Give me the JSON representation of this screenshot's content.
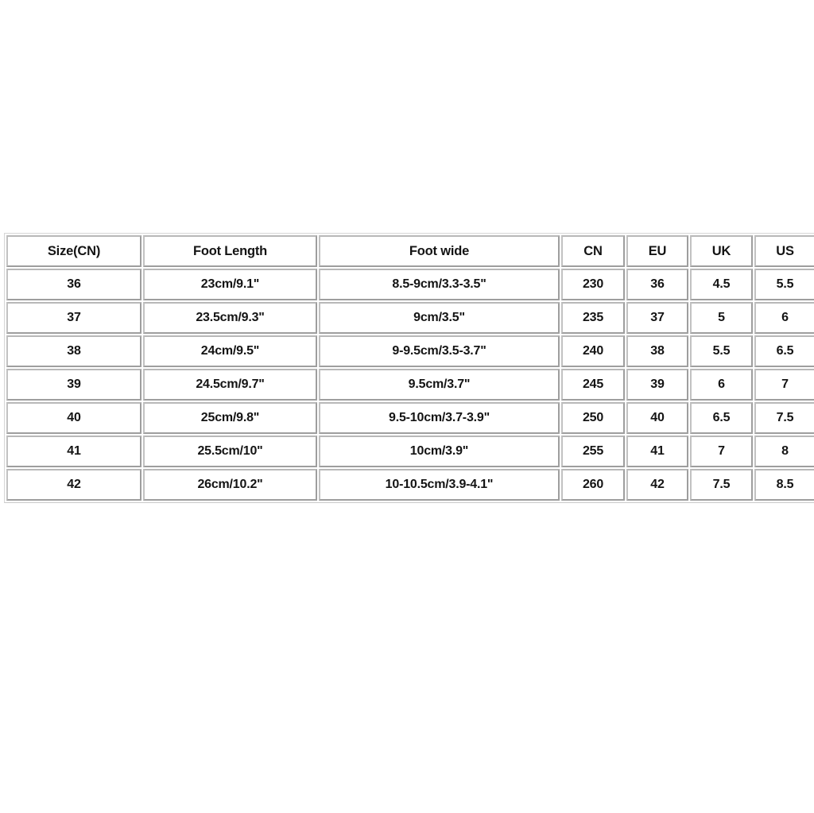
{
  "page": {
    "background_color": "#ffffff",
    "text_color": "#141414",
    "cell_border_color": "#9e9e9e",
    "table_border_color": "#c9c9c9"
  },
  "chart_data": {
    "type": "table",
    "title": "",
    "columns": [
      "Size(CN)",
      "Foot Length",
      "Foot wide",
      "CN",
      "EU",
      "UK",
      "US"
    ],
    "rows": [
      [
        "36",
        "23cm/9.1\"",
        "8.5-9cm/3.3-3.5\"",
        "230",
        "36",
        "4.5",
        "5.5"
      ],
      [
        "37",
        "23.5cm/9.3\"",
        "9cm/3.5\"",
        "235",
        "37",
        "5",
        "6"
      ],
      [
        "38",
        "24cm/9.5\"",
        "9-9.5cm/3.5-3.7\"",
        "240",
        "38",
        "5.5",
        "6.5"
      ],
      [
        "39",
        "24.5cm/9.7\"",
        "9.5cm/3.7\"",
        "245",
        "39",
        "6",
        "7"
      ],
      [
        "40",
        "25cm/9.8\"",
        "9.5-10cm/3.7-3.9\"",
        "250",
        "40",
        "6.5",
        "7.5"
      ],
      [
        "41",
        "25.5cm/10\"",
        "10cm/3.9\"",
        "255",
        "41",
        "7",
        "8"
      ],
      [
        "42",
        "26cm/10.2\"",
        "10-10.5cm/3.9-4.1\"",
        "260",
        "42",
        "7.5",
        "8.5"
      ]
    ]
  }
}
